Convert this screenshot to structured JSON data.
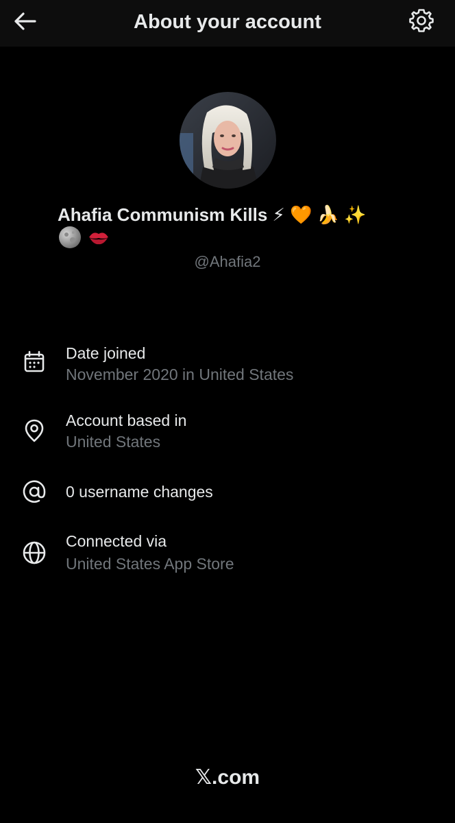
{
  "header": {
    "title": "About your account",
    "back_icon": "arrow-left-icon",
    "settings_icon": "gear-icon"
  },
  "profile": {
    "display_name": "Ahafia Communism Kills ⚡ 🧡 🍌 ✨",
    "name_emojis_line2": [
      "moon-coin-emoji",
      "kiss-mark-emoji"
    ],
    "handle": "@Ahafia2"
  },
  "details": [
    {
      "icon": "calendar-icon",
      "label": "Date joined",
      "value": "November 2020 in United States"
    },
    {
      "icon": "location-pin-icon",
      "label": "Account based in",
      "value": "United States"
    },
    {
      "icon": "at-sign-icon",
      "label": "0 username changes",
      "value": ""
    },
    {
      "icon": "globe-icon",
      "label": "Connected via",
      "value": "United States App Store"
    }
  ],
  "footer": {
    "brand": "𝕏.com"
  },
  "colors": {
    "background": "#000000",
    "header_bg": "#0d0d0d",
    "primary_text": "#e7e9ea",
    "secondary_text": "#71767b"
  }
}
